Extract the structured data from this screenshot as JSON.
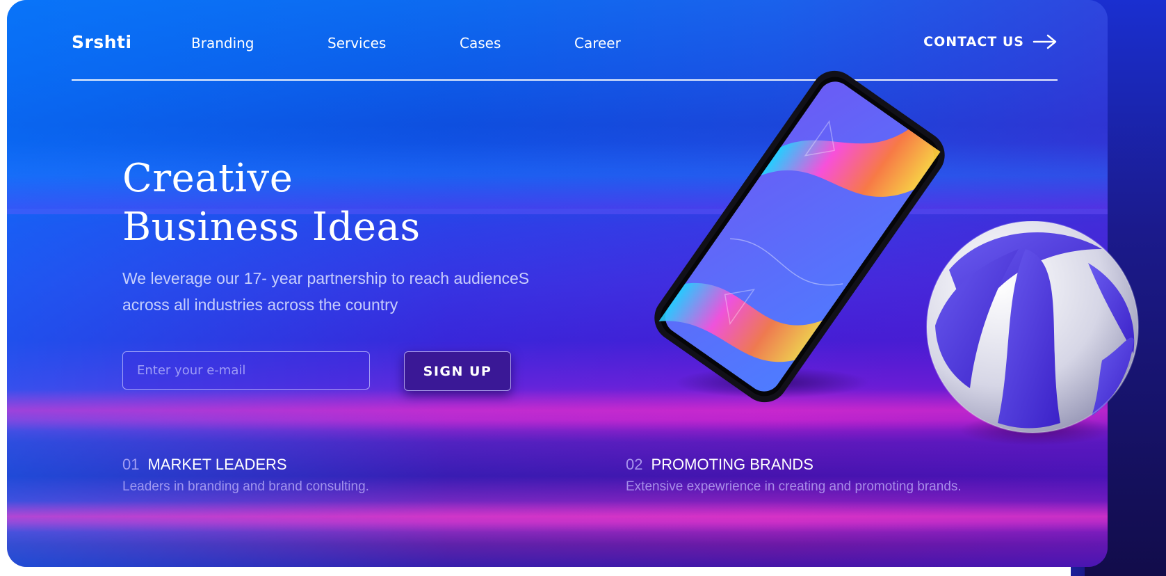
{
  "nav": {
    "logo": "Srshti",
    "links": [
      {
        "label": "Branding"
      },
      {
        "label": "Services"
      },
      {
        "label": "Cases"
      },
      {
        "label": "Career"
      }
    ],
    "contact_label": "CONTACT US"
  },
  "hero": {
    "title_line1": "Creative",
    "title_line2": "Business Ideas",
    "subtitle_line1": "We leverage our 17- year partnership to reach audienceS",
    "subtitle_line2": "across all industries across the country",
    "email_placeholder": "Enter your e-mail",
    "signup_label": "SIGN UP"
  },
  "features": [
    {
      "number": "01",
      "title": "MARKET LEADERS",
      "description": "Leaders in branding and brand consulting."
    },
    {
      "number": "02",
      "title": "PROMOTING BRANDS",
      "description": "Extensive expewrience in creating and promoting brands."
    }
  ],
  "icons": {
    "contact_arrow": "arrow-right-icon",
    "illustration_phone": "phone-icon",
    "illustration_sphere": "sphere-icon"
  },
  "colors": {
    "accent": "#3a1896",
    "text": "#ffffff",
    "gradient_top": "#0a6ff0",
    "gradient_mid": "#3d20d6",
    "gradient_pink": "#b421cf"
  }
}
